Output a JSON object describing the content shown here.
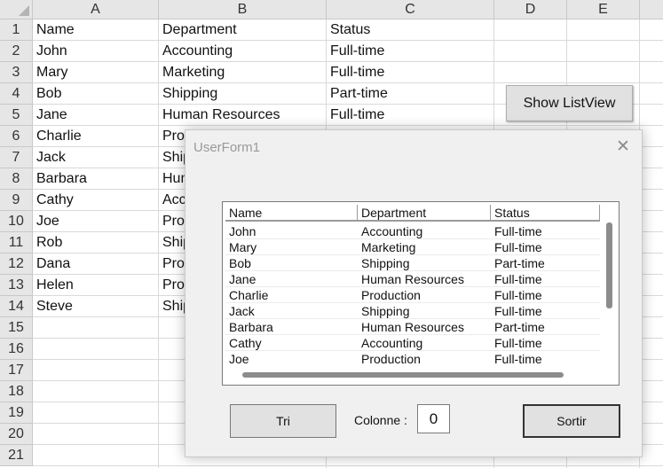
{
  "sheet": {
    "columns": [
      "A",
      "B",
      "C",
      "D",
      "E"
    ],
    "row_numbers": [
      "1",
      "2",
      "3",
      "4",
      "5",
      "6",
      "7",
      "8",
      "9",
      "10",
      "11",
      "12",
      "13",
      "14",
      "15",
      "16",
      "17",
      "18",
      "19",
      "20",
      "21"
    ],
    "header": [
      "Name",
      "Department",
      "Status"
    ],
    "rows": [
      [
        "John",
        "Accounting",
        "Full-time"
      ],
      [
        "Mary",
        "Marketing",
        "Full-time"
      ],
      [
        "Bob",
        "Shipping",
        "Part-time"
      ],
      [
        "Jane",
        "Human Resources",
        "Full-time"
      ],
      [
        "Charlie",
        "Pro",
        ""
      ],
      [
        "Jack",
        "Ship",
        ""
      ],
      [
        "Barbara",
        "Hum",
        ""
      ],
      [
        "Cathy",
        "Acc",
        ""
      ],
      [
        "Joe",
        "Pro",
        ""
      ],
      [
        "Rob",
        "Ship",
        ""
      ],
      [
        "Dana",
        "Pro",
        ""
      ],
      [
        "Helen",
        "Pro",
        ""
      ],
      [
        "Steve",
        "Ship",
        ""
      ]
    ],
    "show_button_label": "Show ListView"
  },
  "form": {
    "title": "UserForm1",
    "close_glyph": "✕",
    "listview": {
      "columns": [
        "Name",
        "Department",
        "Status"
      ],
      "rows": [
        [
          "John",
          "Accounting",
          "Full-time"
        ],
        [
          "Mary",
          "Marketing",
          "Full-time"
        ],
        [
          "Bob",
          "Shipping",
          "Part-time"
        ],
        [
          "Jane",
          "Human Resources",
          "Full-time"
        ],
        [
          "Charlie",
          "Production",
          "Full-time"
        ],
        [
          "Jack",
          "Shipping",
          "Full-time"
        ],
        [
          "Barbara",
          "Human Resources",
          "Part-time"
        ],
        [
          "Cathy",
          "Accounting",
          "Full-time"
        ],
        [
          "Joe",
          "Production",
          "Full-time"
        ]
      ]
    },
    "tri_label": "Tri",
    "colonne_label": "Colonne :",
    "colonne_value": "0",
    "sortir_label": "Sortir"
  }
}
